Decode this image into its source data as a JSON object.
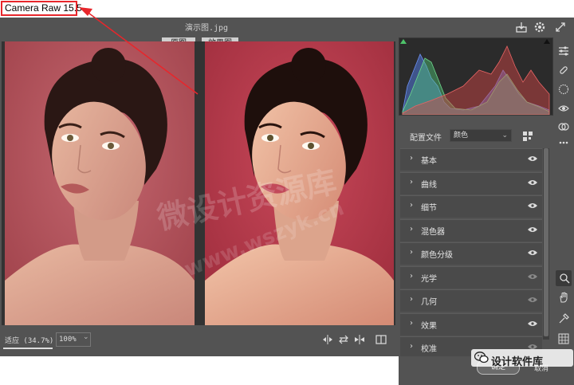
{
  "window": {
    "title": "Camera Raw 15.5"
  },
  "header": {
    "filename": "演示图.jpg"
  },
  "compare": {
    "before_label": "原图",
    "after_label": "效果图"
  },
  "watermark": {
    "text": "微设计资源库",
    "url": "www.wszyk.cn"
  },
  "profile": {
    "label": "配置文件",
    "value": "颜色"
  },
  "panels": [
    {
      "label": "基本"
    },
    {
      "label": "曲线"
    },
    {
      "label": "细节"
    },
    {
      "label": "混色器"
    },
    {
      "label": "颜色分级"
    },
    {
      "label": "光学"
    },
    {
      "label": "几何"
    },
    {
      "label": "效果"
    },
    {
      "label": "校准"
    }
  ],
  "bottom": {
    "fit_label": "适应 (34.7%)",
    "zoom_value": "100%"
  },
  "badge": {
    "text": "设计软件库"
  },
  "dialog": {
    "ok_label": "确定",
    "cancel_label": "取消"
  },
  "colors": {
    "background": "#535353",
    "accent_red": "#e8262b",
    "panel_bg": "#4a4a4a"
  },
  "icons": [
    "save-icon",
    "gear-icon",
    "fullscreen-icon",
    "sliders-icon",
    "heal-icon",
    "mask-icon",
    "redeye-icon",
    "presets-icon",
    "more-icon",
    "zoom-icon",
    "hand-icon",
    "eyedropper-icon",
    "grid-icon"
  ]
}
